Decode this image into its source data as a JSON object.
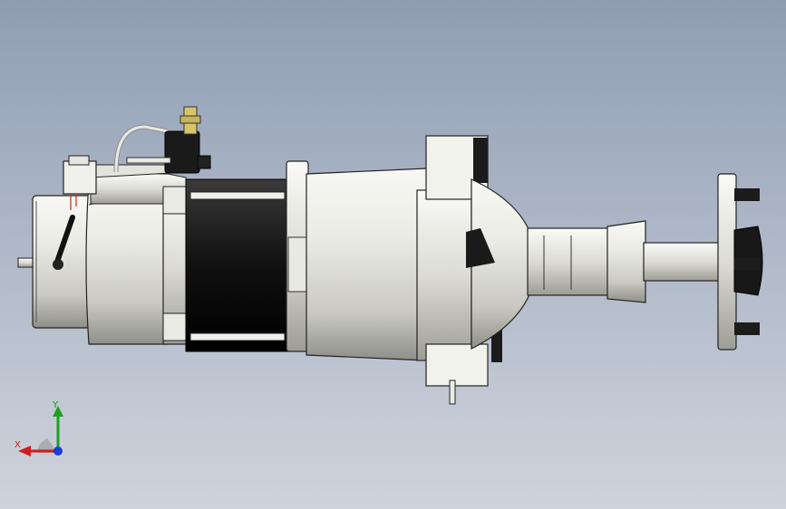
{
  "view": {
    "background_top": "#8f9db3",
    "background_bottom": "#cfd3dc",
    "model_description_icon": "motor-gearbox-assembly-icon"
  },
  "triad": {
    "x_label": "X",
    "y_label": "Y",
    "x_color": "#d21c1c",
    "y_color": "#1ea01e",
    "z_color": "#1c3cd2"
  }
}
